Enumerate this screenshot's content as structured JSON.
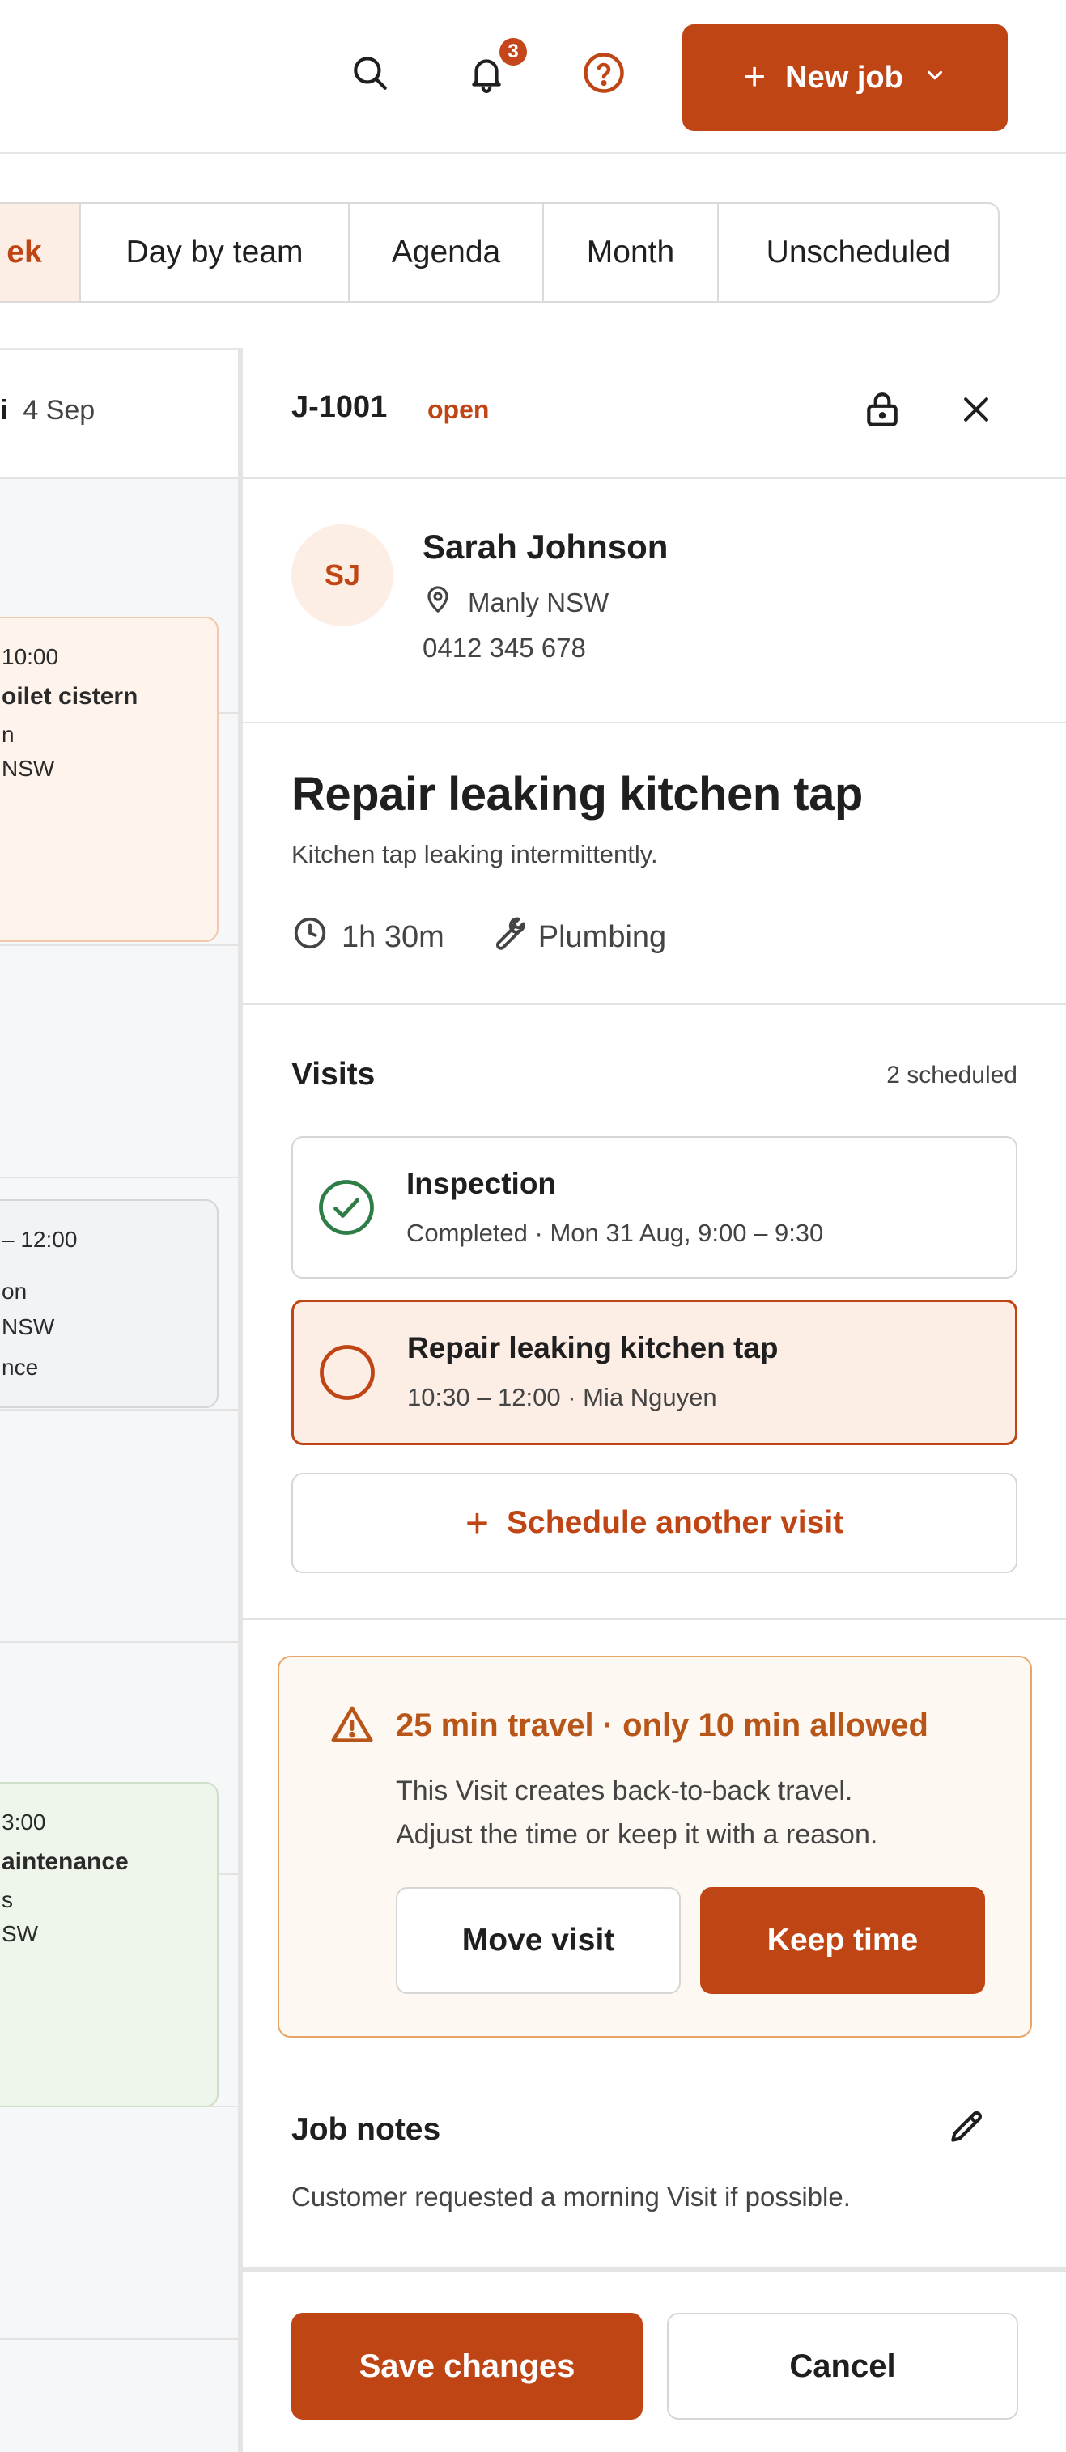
{
  "header": {
    "notification_count": "3",
    "new_job_label": "New job",
    "icons": [
      "search-icon",
      "bell-icon",
      "help-icon",
      "plus-icon",
      "chevron-down-icon"
    ]
  },
  "tabs": [
    {
      "label": "ek",
      "active": true
    },
    {
      "label": "Day by team",
      "active": false
    },
    {
      "label": "Agenda",
      "active": false
    },
    {
      "label": "Month",
      "active": false
    },
    {
      "label": "Unscheduled",
      "active": false
    }
  ],
  "calendar": {
    "day_name": "i",
    "day_date": "4 Sep",
    "cards": [
      {
        "time": "10:00",
        "title": "oilet cistern",
        "line1": "n",
        "line2": "NSW",
        "color": "orange"
      },
      {
        "time": "– 12:00",
        "line1": "on",
        "line2": "NSW",
        "line3": "nce",
        "color": "grey"
      },
      {
        "time": "3:00",
        "title": "aintenance",
        "line1": "s",
        "line2": "SW",
        "color": "green"
      }
    ]
  },
  "job": {
    "id": "J-1001",
    "status": "open",
    "customer": {
      "initials": "SJ",
      "name": "Sarah Johnson",
      "location": "Manly NSW",
      "phone": "0412 345 678"
    },
    "title": "Repair leaking kitchen tap",
    "description": "Kitchen tap leaking intermittently.",
    "duration": "1h 30m",
    "trade": "Plumbing"
  },
  "visits": {
    "heading": "Visits",
    "count_label": "2 scheduled",
    "items": [
      {
        "title": "Inspection",
        "subtitle": "Completed · Mon 31 Aug, 9:00 – 9:30",
        "state": "completed"
      },
      {
        "title": "Repair leaking kitchen tap",
        "subtitle": "10:30 – 12:00 · Mia Nguyen",
        "state": "selected"
      }
    ],
    "schedule_label": "Schedule another visit"
  },
  "warning": {
    "title": "25 min travel · only 10 min allowed",
    "line1": "This Visit creates back-to-back travel.",
    "line2": "Adjust the time or keep it with a reason.",
    "move_label": "Move visit",
    "keep_label": "Keep time"
  },
  "notes": {
    "heading": "Job notes",
    "body": "Customer requested a morning Visit if possible."
  },
  "footer": {
    "save_label": "Save changes",
    "cancel_label": "Cancel"
  },
  "colors": {
    "accent": "#c04515",
    "accent_light": "#fdeee5",
    "success": "#2e7d46",
    "warning": "#b8561a"
  }
}
